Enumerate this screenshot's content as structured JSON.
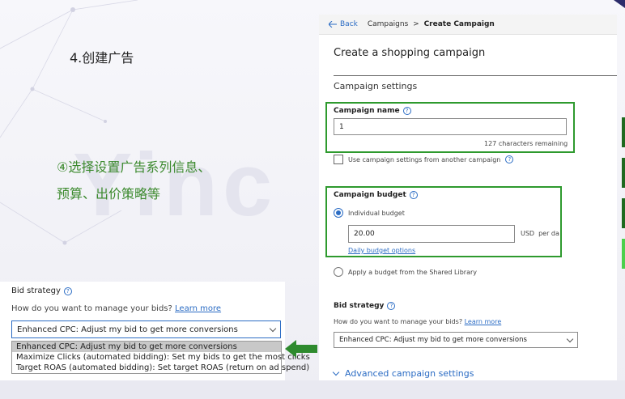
{
  "slide": {
    "step_title": "4.创建广告",
    "note_line1": "④选择设置广告系列信息、",
    "note_line2": "预算、出价策略等",
    "watermark": "Yinc"
  },
  "campaign_page": {
    "topbar": {
      "back": "Back",
      "crumb_parent": "Campaigns",
      "crumb_sep": ">",
      "crumb_current": "Create Campaign"
    },
    "page_title": "Create a shopping campaign",
    "section_title": "Campaign settings",
    "campaign_name": {
      "label": "Campaign name",
      "value": "1",
      "remaining": "127 characters remaining"
    },
    "use_settings_label": "Use campaign settings from another campaign",
    "campaign_budget": {
      "label": "Campaign budget",
      "option_individual": "Individual budget",
      "amount": "20.00",
      "currency": "USD",
      "period": "per day",
      "daily_options_link": "Daily budget options",
      "option_shared": "Apply a budget from the Shared Library"
    },
    "bid_strategy": {
      "label": "Bid strategy",
      "question": "How do you want to manage your bids?",
      "learn_more": "Learn more",
      "selected": "Enhanced CPC: Adjust my bid to get more conversions"
    },
    "advanced": "Advanced campaign settings"
  },
  "bid_panel": {
    "label": "Bid strategy",
    "question": "How do you want to manage your bids?",
    "learn_more": "Learn more",
    "selected": "Enhanced CPC: Adjust my bid to get more conversions",
    "options": [
      "Enhanced CPC: Adjust my bid to get more conversions",
      "Maximize Clicks (automated bidding): Set my bids to get the most clicks",
      "Target ROAS (automated bidding): Set target ROAS (return on ad spend)"
    ]
  },
  "colors": {
    "highlight_green": "#2e9a2e",
    "link_blue": "#2b6cc4",
    "note_green": "#3c8a2e"
  }
}
